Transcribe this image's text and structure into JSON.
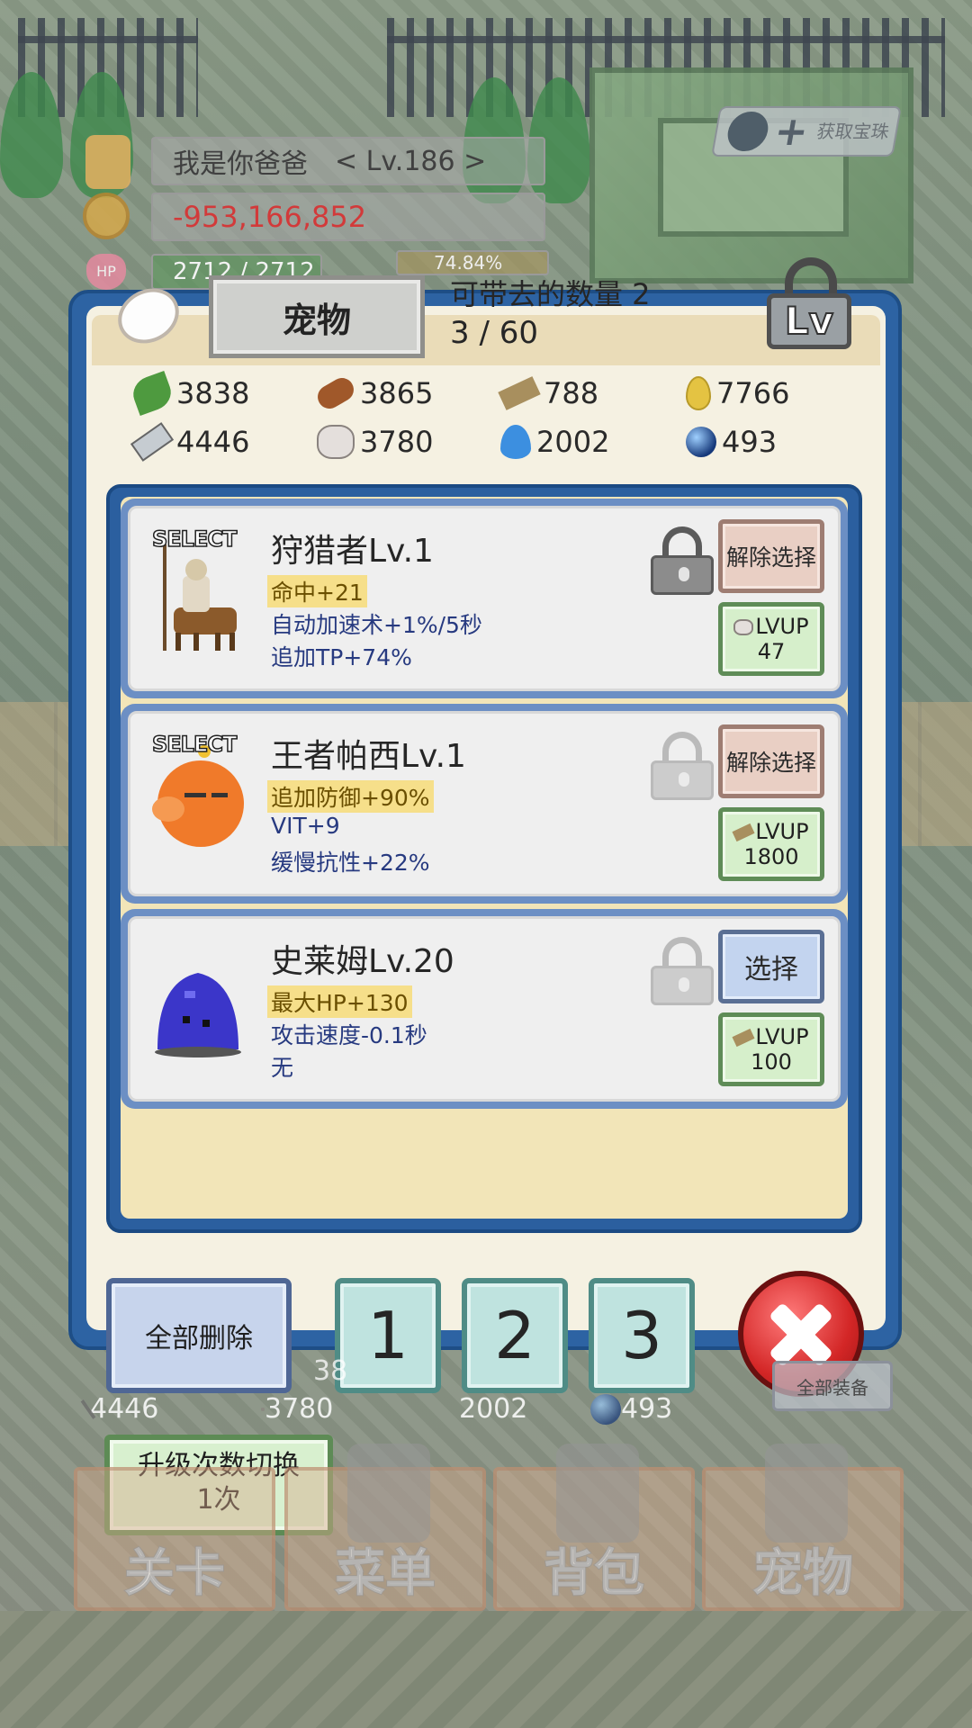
{
  "hud": {
    "player_name": "我是你爸爸",
    "player_level": "< Lv.186 >",
    "gold": "-953,166,852",
    "hp_label": "HP",
    "hp": "2712 / 2712",
    "exp": "74.84%",
    "gem_button_label": "获取宝珠"
  },
  "panel": {
    "title": "宠物",
    "carry_count": "可带去的数量 2",
    "owned_count": "3 / 60",
    "lv_lock_label": "Lv"
  },
  "resources": [
    {
      "icon": "leaf-icon",
      "value": "3838"
    },
    {
      "icon": "log-icon",
      "value": "3865"
    },
    {
      "icon": "plank-icon",
      "value": "788"
    },
    {
      "icon": "drop-icon",
      "value": "7766"
    },
    {
      "icon": "ingot-icon",
      "value": "4446"
    },
    {
      "icon": "stone-icon",
      "value": "3780"
    },
    {
      "icon": "flame-icon",
      "value": "2002"
    },
    {
      "icon": "orb-icon",
      "value": "493"
    }
  ],
  "pets": [
    {
      "select_tag": "SELECT",
      "name": "狩猎者Lv.1",
      "stats": [
        "命中+21",
        "自动加速术+1%/5秒",
        "追加TP+74%"
      ],
      "locked": true,
      "select_button": "解除选择",
      "lvup_label": "LVUP",
      "lvup_material": "stone-icon",
      "lvup_cost": "47"
    },
    {
      "select_tag": "SELECT",
      "name": "王者帕西Lv.1",
      "stats": [
        "追加防御+90%",
        "VIT+9",
        "缓慢抗性+22%"
      ],
      "locked": false,
      "select_button": "解除选择",
      "lvup_label": "LVUP",
      "lvup_material": "plank-icon",
      "lvup_cost": "1800"
    },
    {
      "select_tag": "",
      "name": "史莱姆Lv.20",
      "stats": [
        "最大HP+130",
        "攻击速度-0.1秒",
        "无"
      ],
      "locked": false,
      "select_button": "选择",
      "lvup_label": "LVUP",
      "lvup_material": "plank-icon",
      "lvup_cost": "100"
    }
  ],
  "controls": {
    "delete_all": "全部删除",
    "slot_1": "1",
    "slot_2": "2",
    "slot_3": "3"
  },
  "underlay": {
    "partial_number": "38",
    "ingot": "4446",
    "stone": "3780",
    "flame": "2002",
    "orb": "493",
    "equip_all": "全部装备",
    "upgrade_toggle_line1": "升级次数切换",
    "upgrade_toggle_line2": "1次"
  },
  "nav": {
    "stage": "关卡",
    "menu": "菜单",
    "bag": "背包",
    "pet": "宠物"
  },
  "colors": {
    "panel_frame": "#2d63a3",
    "panel_bg": "#f5f1e2",
    "gold_negative": "#d23a3a",
    "stat_highlight": "#f6df8a",
    "stat_text": "#273a80",
    "close_button": "#d32626"
  }
}
